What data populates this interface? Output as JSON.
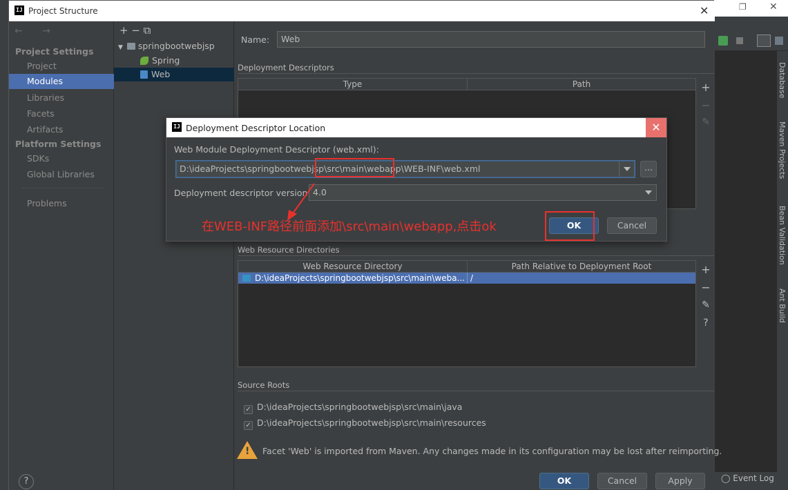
{
  "backdrop": {
    "right_tool_tabs": [
      "Database",
      "Maven Projects",
      "Bean Validation",
      "Ant Build"
    ],
    "event_log": "Event Log"
  },
  "window": {
    "title": "Project Structure",
    "logo_text": "IJ",
    "close_glyph": "✕"
  },
  "nav": {
    "back_forward": "← →",
    "project_settings": "Project Settings",
    "project_items": [
      "Project",
      "Modules",
      "Libraries",
      "Facets",
      "Artifacts"
    ],
    "selected": "Modules",
    "platform_settings": "Platform Settings",
    "platform_items": [
      "SDKs",
      "Global Libraries"
    ],
    "problems": "Problems",
    "help": "?"
  },
  "tree": {
    "toolbar": "+  −  ⧉",
    "root": "springbootwebjsp",
    "children": [
      "Spring",
      "Web"
    ],
    "selected": "Web"
  },
  "facet": {
    "name_label": "Name:",
    "name_value": "Web",
    "deployment_descriptors_title": "Deployment Descriptors",
    "dd_columns": [
      "Type",
      "Path"
    ],
    "web_resource_title": "Web Resource Directories",
    "wr_columns": [
      "Web Resource Directory",
      "Path Relative to Deployment Root"
    ],
    "wr_rows": [
      {
        "dir": "D:\\ideaProjects\\springbootwebjsp\\src\\main\\weba...",
        "path": "/"
      }
    ],
    "source_roots_title": "Source Roots",
    "source_roots": [
      "D:\\ideaProjects\\springbootwebjsp\\src\\main\\java",
      "D:\\ideaProjects\\springbootwebjsp\\src\\main\\resources"
    ],
    "warning": "Facet 'Web' is imported from Maven. Any changes made in its configuration may be lost after reimporting.",
    "tools": {
      "add": "+",
      "remove": "−",
      "edit": "✎",
      "help": "?"
    }
  },
  "footer": {
    "ok": "OK",
    "cancel": "Cancel",
    "apply": "Apply"
  },
  "modal": {
    "title": "Deployment Descriptor Location",
    "descriptor_label": "Web Module Deployment Descriptor (web.xml):",
    "descriptor_path": "D:\\ideaProjects\\springbootwebjsp\\src\\main\\webapp\\WEB-INF\\web.xml",
    "browse": "...",
    "version_label": "Deployment descriptor version",
    "version_value": "4.0",
    "ok": "OK",
    "cancel": "Cancel",
    "close_glyph": "✕"
  },
  "annotation": {
    "text": "在WEB-INF路径前面添加\\src\\main\\webapp,点击ok",
    "color": "#e8312d"
  }
}
